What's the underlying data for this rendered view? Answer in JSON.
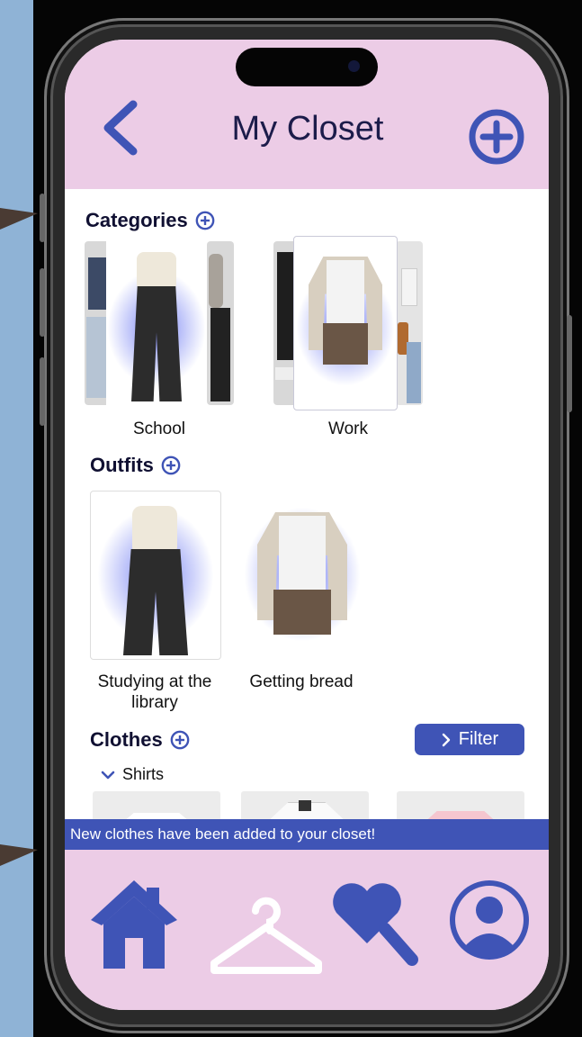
{
  "header": {
    "title": "My Closet"
  },
  "sections": {
    "categories": "Categories",
    "outfits": "Outfits",
    "clothes": "Clothes"
  },
  "categories": [
    {
      "label": "School"
    },
    {
      "label": "Work"
    }
  ],
  "outfits": [
    {
      "label": "Studying at the library"
    },
    {
      "label": "Getting bread"
    }
  ],
  "clothes": {
    "filter_label": "Filter",
    "subcategory": "Shirts"
  },
  "toast": "New clothes have been added to your closet!",
  "nav": [
    "home",
    "closet",
    "favorites",
    "profile"
  ],
  "colors": {
    "accent": "#3f54b6",
    "header_bg": "#eccce6",
    "page_bg": "#8fb3d6"
  }
}
